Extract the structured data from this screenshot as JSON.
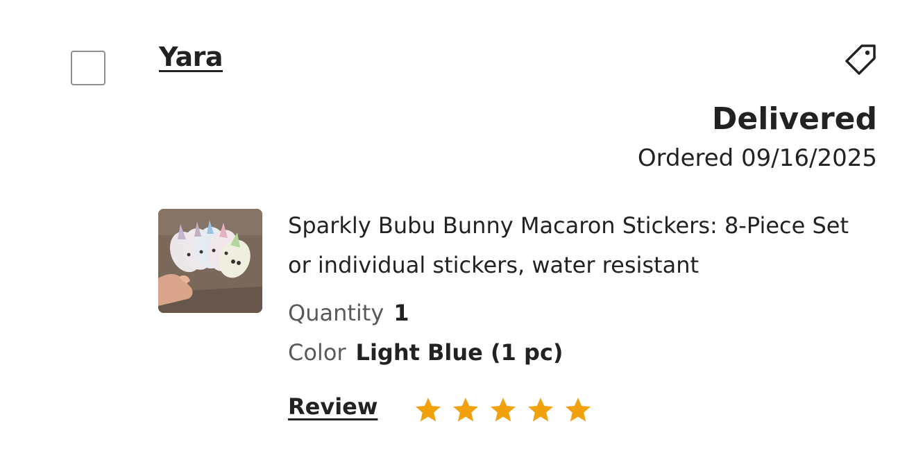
{
  "order": {
    "buyer_name": "Yara",
    "status": "Delivered",
    "ordered_text": "Ordered 09/16/2025",
    "selected": false
  },
  "item": {
    "title": "Sparkly Bubu Bunny Macaron Stickers: 8-Piece Set or individual stickers, water resistant",
    "quantity_label": "Quantity",
    "quantity_value": "1",
    "color_label": "Color",
    "color_value": "Light Blue (1 pc)"
  },
  "review": {
    "label": "Review",
    "star_count": 5,
    "rating": 5,
    "star_color": "#F1A10C"
  },
  "icons": {
    "tag": "tag-icon",
    "star": "star-icon"
  }
}
